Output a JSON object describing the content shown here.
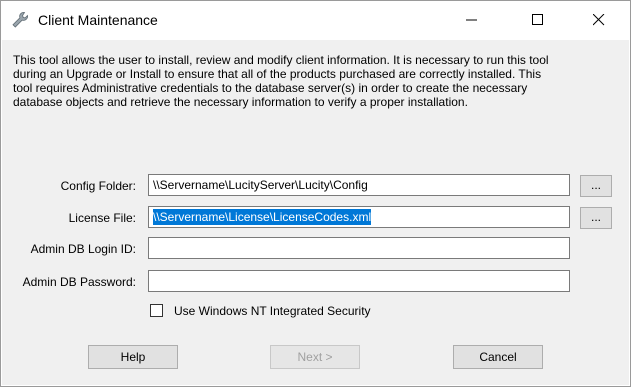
{
  "window": {
    "title": "Client Maintenance",
    "icon": "wrench-icon"
  },
  "description": "This tool allows the user to install, review and modify client information.  It is necessary to run this tool\nduring an Upgrade or Install to ensure that all of the products purchased are correctly installed.  This\ntool requires Administrative credentials to the database server(s) in order to create the necessary\ndatabase objects and retrieve the necessary information to verify a proper installation.",
  "form": {
    "config_folder": {
      "label": "Config Folder:",
      "value": "\\\\Servername\\LucityServer\\Lucity\\Config",
      "browse_label": "..."
    },
    "license_file": {
      "label": "License File:",
      "value": "\\\\Servername\\License\\LicenseCodes.xml",
      "browse_label": "..."
    },
    "admin_login": {
      "label": "Admin DB Login ID:",
      "value": ""
    },
    "admin_password": {
      "label": "Admin DB Password:",
      "value": ""
    },
    "integrated_security": {
      "label": "Use Windows NT Integrated Security",
      "checked": false
    }
  },
  "buttons": {
    "help": "Help",
    "next": "Next >",
    "cancel": "Cancel"
  }
}
